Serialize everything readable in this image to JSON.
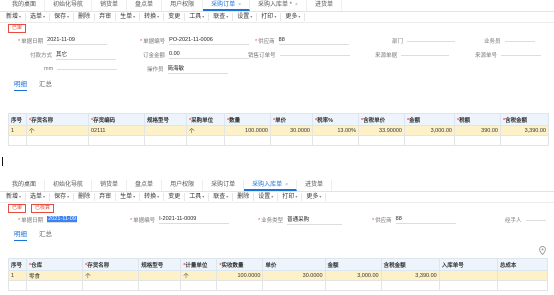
{
  "top": {
    "tabs": [
      {
        "label": "我的桌面",
        "closable": false,
        "active": false
      },
      {
        "label": "初始化导航",
        "closable": false,
        "active": false
      },
      {
        "label": "销货单",
        "closable": false,
        "active": false
      },
      {
        "label": "盘点单",
        "closable": false,
        "active": false
      },
      {
        "label": "用户权限",
        "closable": false,
        "active": false
      },
      {
        "label": "采购订单",
        "closable": true,
        "active": true
      },
      {
        "label": "采购入库单 *",
        "closable": true,
        "active": false
      },
      {
        "label": "进货单",
        "closable": false,
        "active": false
      }
    ],
    "toolbar": [
      {
        "label": "新增",
        "dropdown": true
      },
      {
        "label": "选单",
        "dropdown": true
      },
      {
        "label": "保存",
        "dropdown": true
      },
      {
        "label": "删除",
        "dropdown": false
      },
      {
        "label": "弃审",
        "dropdown": false
      },
      {
        "label": "生单",
        "dropdown": true
      },
      {
        "label": "转换",
        "dropdown": true
      },
      {
        "label": "变更",
        "dropdown": false
      },
      {
        "label": "工具",
        "dropdown": true
      },
      {
        "label": "联查",
        "dropdown": true
      },
      {
        "label": "设置",
        "dropdown": true
      },
      {
        "label": "打印",
        "dropdown": true
      },
      {
        "label": "更多",
        "dropdown": true
      }
    ],
    "status_badges": [
      "已审"
    ],
    "fields": {
      "doc_date_label": "单据日期",
      "doc_date": "2021-11-09",
      "doc_no_label": "单据编号",
      "doc_no": "PO-2021-11-0006",
      "vendor_label": "供应商",
      "vendor": "88",
      "dept_label": "部门",
      "dept": "",
      "salesman_label": "业务员",
      "salesman": "",
      "payment_label": "付款方式",
      "payment": "其它",
      "order_amount_label": "订金金额",
      "order_amount": "0.00",
      "sales_order_label": "销售订单号",
      "sales_order": "",
      "source_type_label": "来源单据",
      "source_type": "",
      "source_no_label": "来源单号",
      "source_no": "",
      "memo_label": "mm",
      "memo": "",
      "operator_label": "操作员",
      "operator": "简海敏"
    },
    "subtabs": [
      "明细",
      "汇总"
    ],
    "table": {
      "headers": [
        "序号",
        "存货名称",
        "存货编码",
        "规格型号",
        "采购单位",
        "数量",
        "单价",
        "税率%",
        "含税单价",
        "金额",
        "税额",
        "含税金额"
      ],
      "starred": [
        false,
        true,
        true,
        false,
        true,
        true,
        true,
        true,
        true,
        true,
        true,
        true
      ],
      "rows": [
        [
          "1",
          "个",
          "02111",
          "",
          "个",
          "100.0000",
          "30.0000",
          "13.00%",
          "33.90000",
          "3,000.00",
          "390.00",
          "3,390.00"
        ],
        [
          "",
          "",
          "",
          "",
          "",
          "",
          "",
          "",
          "",
          "",
          "",
          ""
        ]
      ]
    }
  },
  "bottom": {
    "tabs": [
      {
        "label": "我的桌面",
        "closable": false,
        "active": false
      },
      {
        "label": "初始化导航",
        "closable": false,
        "active": false
      },
      {
        "label": "销货单",
        "closable": false,
        "active": false
      },
      {
        "label": "盘点单",
        "closable": false,
        "active": false
      },
      {
        "label": "用户权限",
        "closable": false,
        "active": false
      },
      {
        "label": "采购订单",
        "closable": false,
        "active": false
      },
      {
        "label": "采购入库单",
        "closable": true,
        "active": true
      },
      {
        "label": "进货单",
        "closable": false,
        "active": false
      }
    ],
    "toolbar": [
      {
        "label": "新增",
        "dropdown": true
      },
      {
        "label": "选单",
        "dropdown": true
      },
      {
        "label": "保存",
        "dropdown": true
      },
      {
        "label": "删除",
        "dropdown": false
      },
      {
        "label": "弃审",
        "dropdown": false
      },
      {
        "label": "生单",
        "dropdown": true
      },
      {
        "label": "转换",
        "dropdown": true
      },
      {
        "label": "变更",
        "dropdown": false
      },
      {
        "label": "工具",
        "dropdown": true
      },
      {
        "label": "联查",
        "dropdown": true
      },
      {
        "label": "删除",
        "dropdown": false
      },
      {
        "label": "设置",
        "dropdown": true
      },
      {
        "label": "打印",
        "dropdown": true
      },
      {
        "label": "更多",
        "dropdown": true
      }
    ],
    "status_badges": [
      "已审",
      "已核算"
    ],
    "fields": {
      "doc_date_label": "单据日期",
      "doc_date": "2021-11-09",
      "doc_no_label": "单据编号",
      "doc_no": "I-2021-11-0009",
      "biz_type_label": "业务类型",
      "biz_type": "普通采购",
      "vendor_label": "供应商",
      "vendor": "88",
      "handler_label": "经手人",
      "handler": ""
    },
    "subtabs": [
      "明细",
      "汇总"
    ],
    "table": {
      "headers": [
        "序号",
        "仓库",
        "存货名称",
        "规格型号",
        "计量单位",
        "实收数量",
        "单价",
        "金额",
        "含税金额",
        "入库单号",
        "总成本"
      ],
      "starred": [
        false,
        true,
        true,
        false,
        true,
        true,
        false,
        false,
        false,
        false,
        false
      ],
      "rows": [
        [
          "1",
          "零食",
          "个",
          "",
          "个",
          "100.0000",
          "30.0000",
          "3,000.00",
          "3,390.00",
          "",
          ""
        ],
        [
          "",
          "",
          "",
          "",
          "",
          "",
          "",
          "",
          "",
          "",
          ""
        ]
      ]
    }
  },
  "icons": {
    "location": "location-pin-icon"
  }
}
